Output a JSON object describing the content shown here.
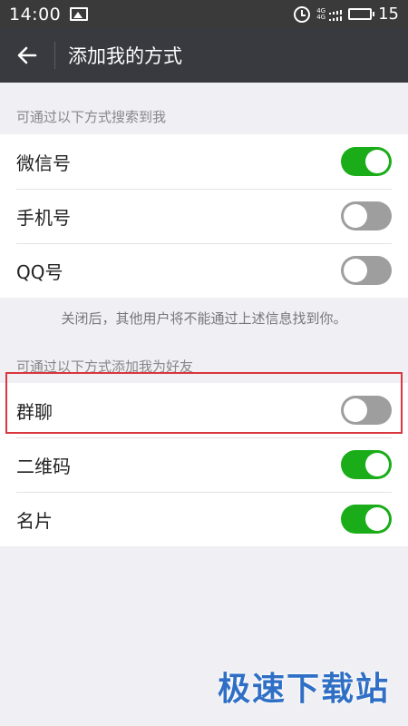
{
  "status_bar": {
    "time": "14:00",
    "network_top": "4G",
    "network_bottom": "4G",
    "battery_level": "15",
    "icons": [
      "gallery-icon",
      "alarm-icon",
      "signal-icon",
      "battery-icon"
    ]
  },
  "header": {
    "title": "添加我的方式",
    "back_icon": "arrow-left-icon"
  },
  "search_section": {
    "header": "可通过以下方式搜索到我",
    "items": [
      {
        "label": "微信号",
        "enabled": true
      },
      {
        "label": "手机号",
        "enabled": false
      },
      {
        "label": "QQ号",
        "enabled": false
      }
    ],
    "note": "关闭后，其他用户将不能通过上述信息找到你。"
  },
  "add_section": {
    "header": "可通过以下方式添加我为好友",
    "items": [
      {
        "label": "群聊",
        "enabled": false
      },
      {
        "label": "二维码",
        "enabled": true
      },
      {
        "label": "名片",
        "enabled": true
      }
    ]
  },
  "colors": {
    "toggle_on": "#1aad19",
    "toggle_off": "#9e9e9e",
    "header_bg": "#393a3f",
    "highlight": "#d9363e"
  },
  "watermark": "极速下载站"
}
